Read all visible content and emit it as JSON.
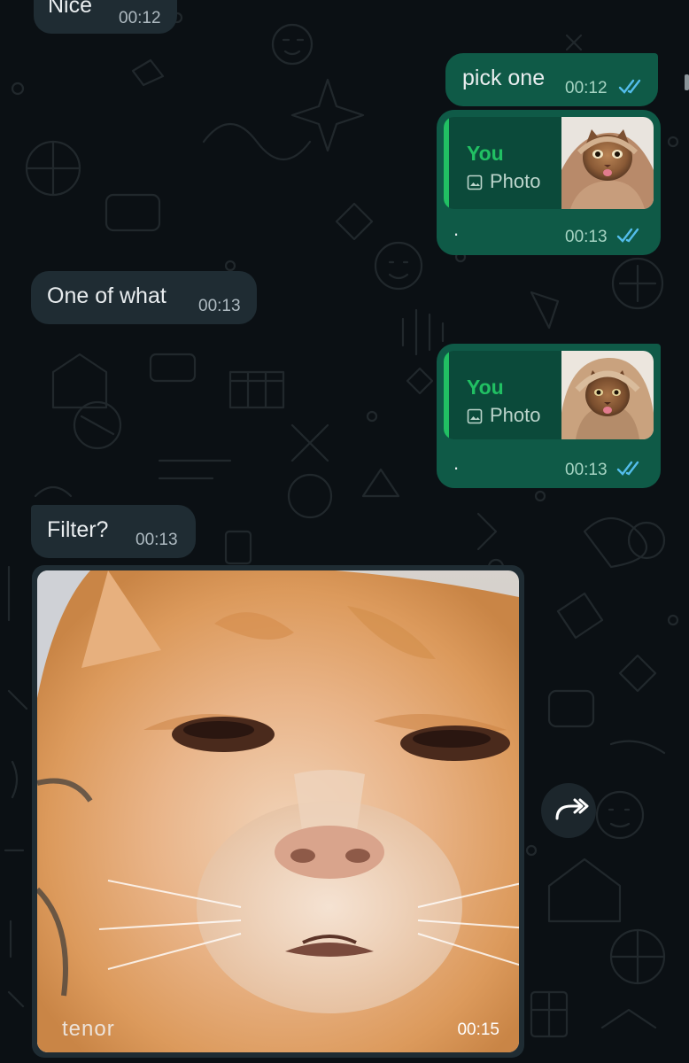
{
  "messages": [
    {
      "id": "m0",
      "direction": "incoming",
      "text": "Nice",
      "time": "00:12"
    },
    {
      "id": "m1",
      "direction": "outgoing",
      "text": "pick one",
      "time": "00:12",
      "status": "read"
    },
    {
      "id": "m2",
      "direction": "outgoing",
      "quote": {
        "sender": "You",
        "type": "Photo"
      },
      "text": ".",
      "time": "00:13",
      "status": "read"
    },
    {
      "id": "m3",
      "direction": "incoming",
      "text": "One of what",
      "time": "00:13"
    },
    {
      "id": "m4",
      "direction": "outgoing",
      "quote": {
        "sender": "You",
        "type": "Photo"
      },
      "text": ".",
      "time": "00:13",
      "status": "read"
    },
    {
      "id": "m5",
      "direction": "incoming",
      "text": "Filter?",
      "time": "00:13"
    },
    {
      "id": "m6",
      "direction": "incoming",
      "media": "gif",
      "watermark": "tenor",
      "time": "00:15"
    }
  ],
  "icons": {
    "read_ticks": "double-check-icon",
    "photo": "photo-icon",
    "forward": "forward-icon"
  },
  "colors": {
    "background": "#0b1014",
    "incoming_bubble": "#1f2c33",
    "outgoing_bubble": "#0f5a47",
    "quote_accent": "#21c063",
    "read_tick": "#53bdeb"
  }
}
